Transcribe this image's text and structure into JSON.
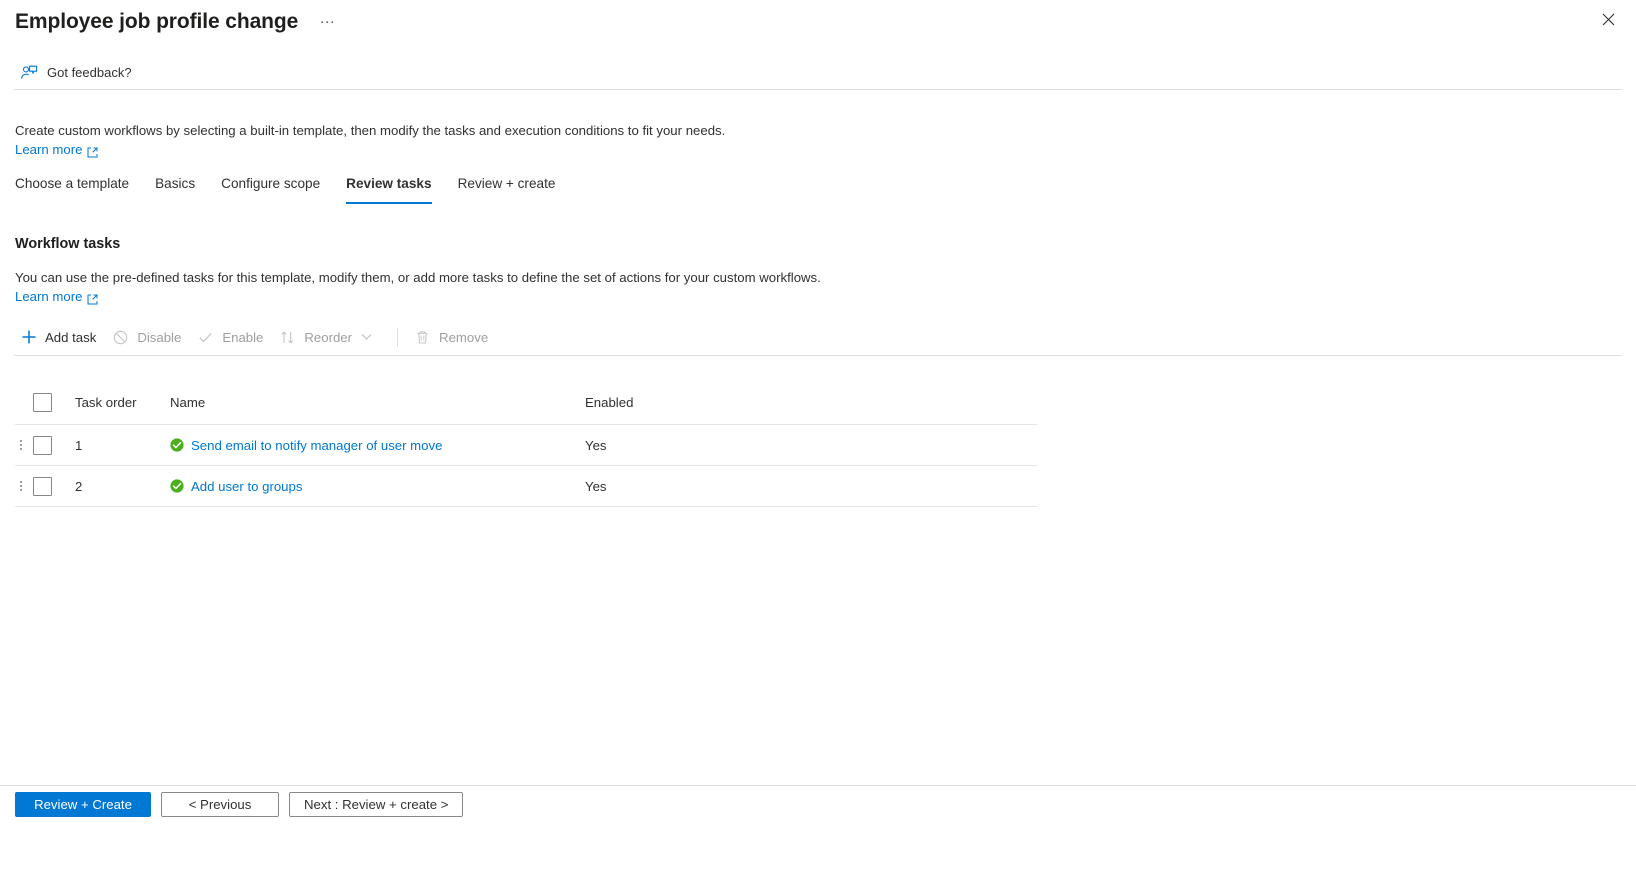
{
  "blade": {
    "title": "Employee job profile change",
    "more_label": "…",
    "close_icon": "close-icon"
  },
  "feedback": {
    "label": "Got feedback?",
    "icon": "feedback-person-icon"
  },
  "intro": {
    "text": "Create custom workflows by selecting a built-in template, then modify the tasks and execution conditions to fit your needs.",
    "learn_more": "Learn more"
  },
  "tabs": [
    {
      "label": "Choose a template",
      "active": false
    },
    {
      "label": "Basics",
      "active": false
    },
    {
      "label": "Configure scope",
      "active": false
    },
    {
      "label": "Review tasks",
      "active": true
    },
    {
      "label": "Review + create",
      "active": false
    }
  ],
  "section": {
    "title": "Workflow tasks",
    "description": "You can use the pre-defined tasks for this template, modify them, or add more tasks to define the set of actions for your custom workflows.",
    "learn_more": "Learn more"
  },
  "commandbar": [
    {
      "label": "Add task",
      "icon": "plus-icon",
      "disabled": false
    },
    {
      "label": "Disable",
      "icon": "block-icon",
      "disabled": true
    },
    {
      "label": "Enable",
      "icon": "checkmark-icon",
      "disabled": true
    },
    {
      "label": "Reorder",
      "icon": "sort-arrows-icon",
      "disabled": true,
      "chevron": true
    },
    {
      "label": "Remove",
      "icon": "trash-icon",
      "disabled": true
    }
  ],
  "table": {
    "columns": [
      "Task order",
      "Name",
      "Enabled"
    ],
    "rows": [
      {
        "order": "1",
        "name": "Send email to notify manager of user move",
        "enabled": "Yes",
        "status_icon": "green-check-circle-icon"
      },
      {
        "order": "2",
        "name": "Add user to groups",
        "enabled": "Yes",
        "status_icon": "green-check-circle-icon"
      }
    ]
  },
  "footer": {
    "primary": "Review + Create",
    "previous": "< Previous",
    "next": "Next : Review + create >"
  },
  "colors": {
    "accent": "#0078d4",
    "success": "#4caf1d",
    "text": "#323130",
    "disabled": "#a19f9d",
    "border": "#e1dfdd"
  }
}
